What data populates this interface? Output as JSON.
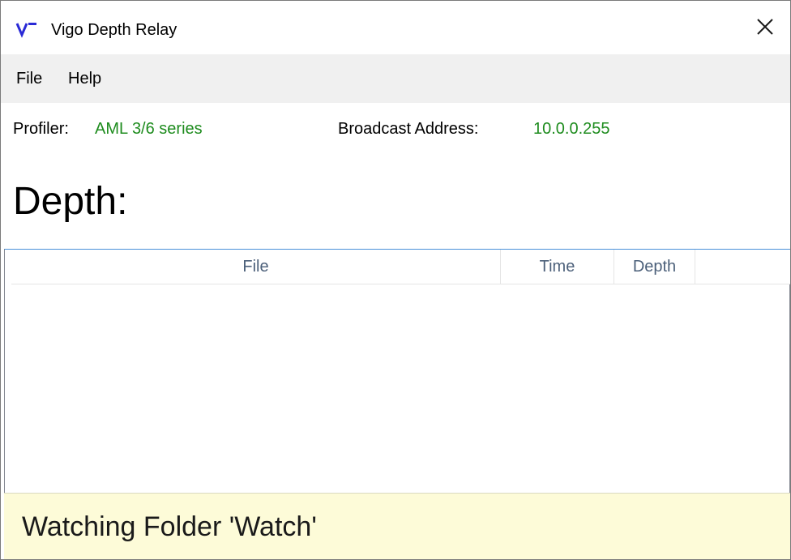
{
  "window": {
    "title": "Vigo Depth Relay",
    "icon": "vigo-logo-icon",
    "close_icon": "close-icon"
  },
  "menu": {
    "items": [
      {
        "label": "File"
      },
      {
        "label": "Help"
      }
    ]
  },
  "info": {
    "profiler_label": "Profiler:",
    "profiler_value": "AML 3/6 series",
    "broadcast_label": "Broadcast Address:",
    "broadcast_value": "10.0.0.255",
    "value_color": "#1e8c1e"
  },
  "depth": {
    "label": "Depth:"
  },
  "table": {
    "columns": [
      "File",
      "Time",
      "Depth"
    ],
    "rows": []
  },
  "status": {
    "text": "Watching Folder 'Watch'",
    "background": "#fdfbd8"
  }
}
